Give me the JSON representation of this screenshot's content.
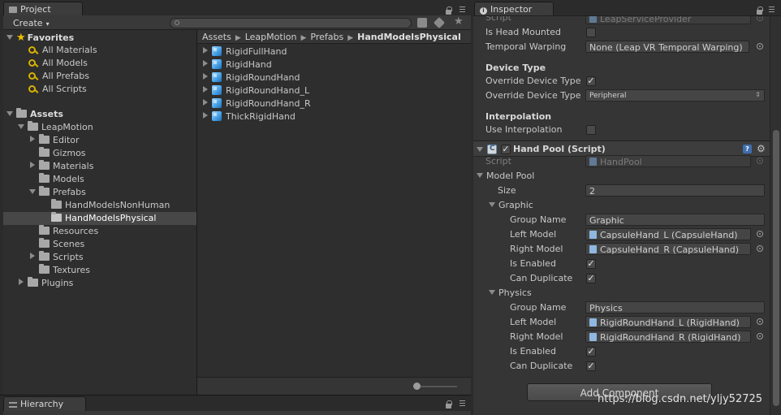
{
  "project": {
    "tab_label": "Project",
    "create_label": "Create",
    "favorites": {
      "title": "Favorites",
      "items": [
        "All Materials",
        "All Models",
        "All Prefabs",
        "All Scripts"
      ]
    },
    "assets_title": "Assets",
    "tree": [
      {
        "label": "LeapMotion",
        "expanded": true
      },
      {
        "label": "Editor"
      },
      {
        "label": "Gizmos"
      },
      {
        "label": "Materials"
      },
      {
        "label": "Models"
      },
      {
        "label": "Prefabs",
        "expanded": true
      },
      {
        "label": "HandModelsNonHuman"
      },
      {
        "label": "HandModelsPhysical",
        "selected": true
      },
      {
        "label": "Resources"
      },
      {
        "label": "Scenes"
      },
      {
        "label": "Scripts"
      },
      {
        "label": "Textures"
      },
      {
        "label": "Plugins"
      }
    ],
    "breadcrumb": [
      "Assets",
      "LeapMotion",
      "Prefabs",
      "HandModelsPhysical"
    ],
    "files": [
      "RigidFullHand",
      "RigidHand",
      "RigidRoundHand",
      "RigidRoundHand_L",
      "RigidRoundHand_R",
      "ThickRigidHand"
    ]
  },
  "hierarchy": {
    "tab_label": "Hierarchy"
  },
  "inspector": {
    "tab_label": "Inspector",
    "top_script_label": "Script",
    "top_script_value": "LeapServiceProvider",
    "is_head_mounted_label": "Is Head Mounted",
    "temporal_warping_label": "Temporal Warping",
    "temporal_warping_value": "None (Leap VR Temporal Warping)",
    "device_type_header": "Device Type",
    "override_device_type_label_1": "Override Device Type",
    "override_device_type_label_2": "Override Device Type",
    "override_device_type_value": "Peripheral",
    "interpolation_header": "Interpolation",
    "use_interpolation_label": "Use Interpolation",
    "component_title": "Hand Pool (Script)",
    "script_label": "Script",
    "script_value": "HandPool",
    "model_pool_label": "Model Pool",
    "size_label": "Size",
    "size_value": "2",
    "graphic": {
      "foldout_label": "Graphic",
      "group_name_label": "Group Name",
      "group_name_value": "Graphic",
      "left_model_label": "Left Model",
      "left_model_value": "CapsuleHand_L (CapsuleHand)",
      "right_model_label": "Right Model",
      "right_model_value": "CapsuleHand_R (CapsuleHand)",
      "is_enabled_label": "Is Enabled",
      "can_duplicate_label": "Can Duplicate"
    },
    "physics": {
      "foldout_label": "Physics",
      "group_name_label": "Group Name",
      "group_name_value": "Physics",
      "left_model_label": "Left Model",
      "left_model_value": "RigidRoundHand_L (RigidHand)",
      "right_model_label": "Right Model",
      "right_model_value": "RigidRoundHand_R (RigidHand)",
      "is_enabled_label": "Is Enabled",
      "can_duplicate_label": "Can Duplicate"
    },
    "add_component_label": "Add Component"
  },
  "watermark": "https://blog.csdn.net/yljy52725",
  "checkmark": "✓",
  "colors": {
    "panel_bg": "#353535",
    "selection": "#474747",
    "folder_icon": "#a8a8a8",
    "prefab_icon": "#4aa3e8",
    "favorite_icon": "#d8b000"
  }
}
